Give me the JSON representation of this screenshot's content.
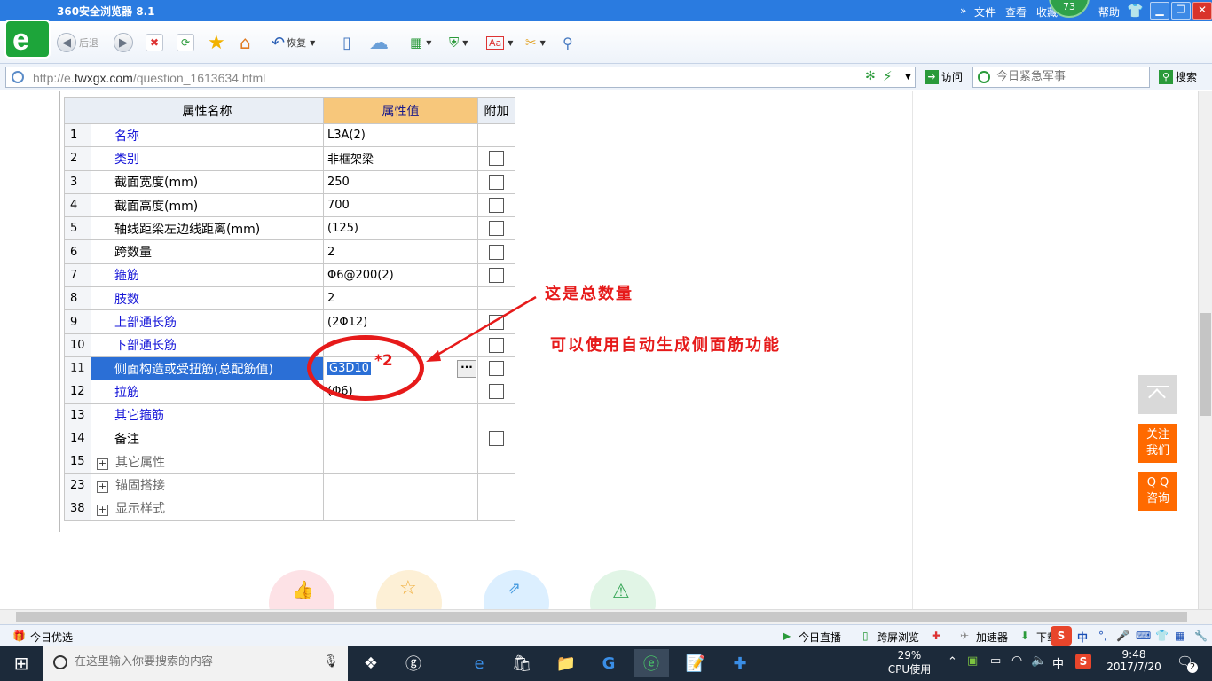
{
  "browser": {
    "title": "360安全浏览器 8.1",
    "menu": [
      "文件",
      "查看",
      "收藏",
      "帮助"
    ],
    "badge": "73",
    "url_prefix": "http://e.",
    "url_domain": "fwxgx.com",
    "url_path": "/question_1613634.html",
    "back_label": "后退",
    "restore_label": "恢复",
    "visit_label": "访问",
    "search_placeholder": "今日紧急军事",
    "search_label": "搜索"
  },
  "table": {
    "headers": {
      "name": "属性名称",
      "value": "属性值",
      "extra": "附加"
    },
    "rows": [
      {
        "num": "1",
        "name": "名称",
        "value": "L3A(2)"
      },
      {
        "num": "2",
        "name": "类别",
        "value": "非框架梁"
      },
      {
        "num": "3",
        "name": "截面宽度(mm)",
        "value": "250"
      },
      {
        "num": "4",
        "name": "截面高度(mm)",
        "value": "700"
      },
      {
        "num": "5",
        "name": "轴线距梁左边线距离(mm)",
        "value": "(125)"
      },
      {
        "num": "6",
        "name": "跨数量",
        "value": "2"
      },
      {
        "num": "7",
        "name": "箍筋",
        "value": "Φ6@200(2)"
      },
      {
        "num": "8",
        "name": "肢数",
        "value": "2"
      },
      {
        "num": "9",
        "name": "上部通长筋",
        "value": "(2Φ12)"
      },
      {
        "num": "10",
        "name": "下部通长筋",
        "value": ""
      },
      {
        "num": "11",
        "name": "侧面构造或受扭筋(总配筋值)",
        "value": "G3D10"
      },
      {
        "num": "12",
        "name": "拉筋",
        "value": "(Φ6)"
      },
      {
        "num": "13",
        "name": "其它箍筋",
        "value": ""
      },
      {
        "num": "14",
        "name": "备注",
        "value": ""
      },
      {
        "num": "15",
        "name": "其它属性",
        "value": ""
      },
      {
        "num": "23",
        "name": "锚固搭接",
        "value": ""
      },
      {
        "num": "38",
        "name": "显示样式",
        "value": ""
      }
    ],
    "dots_label": "···"
  },
  "annotations": {
    "multiplier": "*2",
    "total_note": "这是总数量",
    "auto_note": "可以使用自动生成侧面筋功能"
  },
  "floating": {
    "follow": [
      "关注",
      "我们"
    ],
    "qq": [
      "Q Q",
      "咨询"
    ]
  },
  "statusbar": {
    "left": "今日优选",
    "live": "今日直播",
    "cross_screen": "跨屏浏览",
    "accelerator": "加速器",
    "download": "下载",
    "ime": "中"
  },
  "taskbar": {
    "search_placeholder": "在这里输入你要搜索的内容",
    "cpu_percent": "29%",
    "cpu_label": "CPU使用",
    "ime": "中",
    "time": "9:48",
    "date": "2017/7/20",
    "notifications": "2"
  },
  "colors": {
    "accent_blue": "#2a7be0",
    "selection_blue": "#2b6fd6",
    "header_orange": "#f7c77b",
    "annotation_red": "#e61a1a",
    "float_orange": "#ff6a00"
  }
}
